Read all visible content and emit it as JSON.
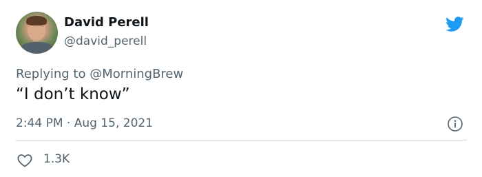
{
  "tweet": {
    "author_name": "David Perell",
    "author_handle": "@david_perell",
    "reply_prefix": "Replying to ",
    "reply_mention": "@MorningBrew",
    "text": "“I don’t know”",
    "timestamp": "2:44 PM · Aug 15, 2021",
    "like_count": "1.3K"
  },
  "icons": {
    "brand": "twitter-bird-icon",
    "info": "info-icon",
    "like": "heart-icon"
  },
  "colors": {
    "brand": "#1d9bf0",
    "secondary_text": "#536471",
    "divider": "#cfd9de"
  }
}
